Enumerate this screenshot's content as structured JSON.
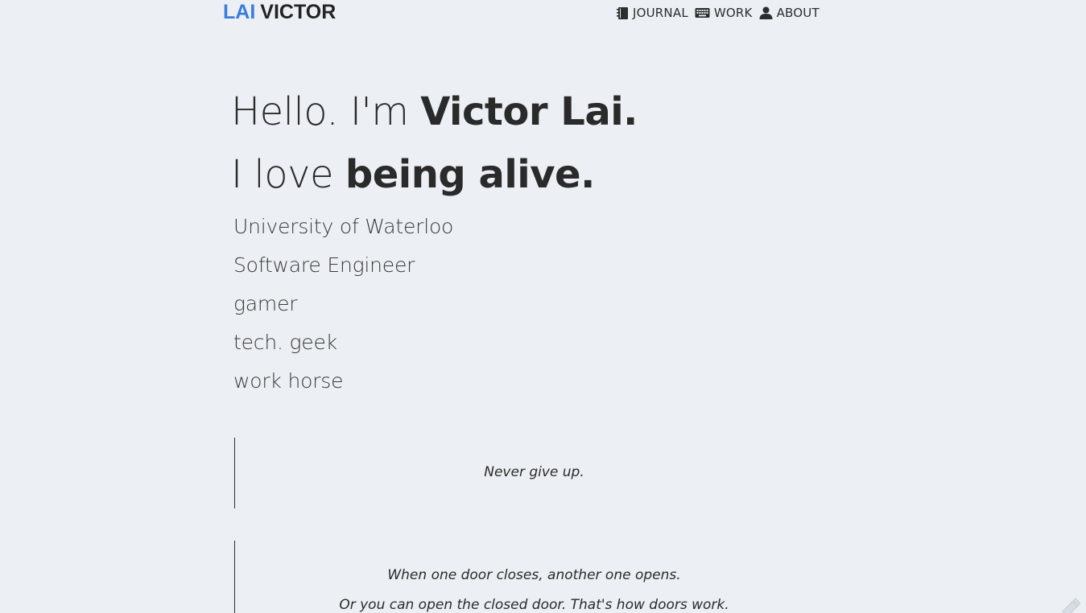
{
  "header": {
    "logo_first": "LAI",
    "logo_last": "VICTOR",
    "nav": [
      {
        "label": "JOURNAL",
        "icon": "notebook-icon"
      },
      {
        "label": "WORK",
        "icon": "keyboard-icon"
      },
      {
        "label": "ABOUT",
        "icon": "user-icon"
      }
    ]
  },
  "hero": {
    "line1_prefix": "Hello. I'm",
    "line1_bold": "Victor Lai.",
    "line2_prefix": "I love",
    "line2_bold": "being alive."
  },
  "tags": [
    "University of Waterloo",
    "Software Engineer",
    "gamer",
    "tech. geek",
    "work horse"
  ],
  "quotes": [
    {
      "lines": [
        "Never give up."
      ]
    },
    {
      "lines": [
        "When one door closes, another one opens.",
        "Or you can open the closed door. That's how doors work."
      ]
    }
  ],
  "colors": {
    "background": "#ecf0f4",
    "logo_accent": "#3b7ddd",
    "text": "#2b2b2b"
  }
}
